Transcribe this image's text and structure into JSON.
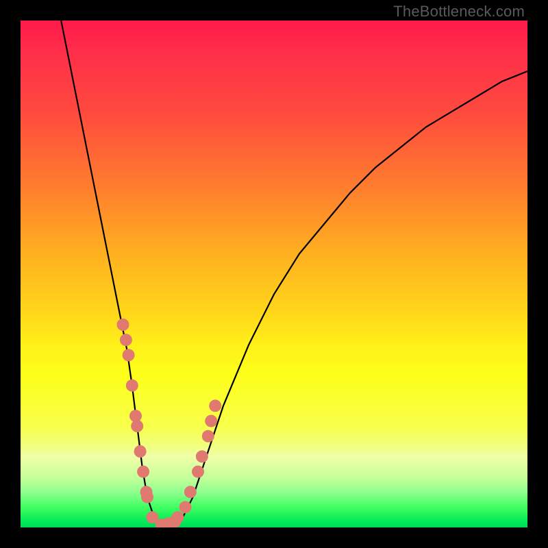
{
  "watermark": "TheBottleneck.com",
  "chart_data": {
    "type": "line",
    "title": "",
    "xlabel": "",
    "ylabel": "",
    "xlim": [
      0,
      100
    ],
    "ylim": [
      0,
      100
    ],
    "curve": {
      "name": "bottleneck-curve",
      "x": [
        8,
        10,
        12,
        14,
        16,
        18,
        20,
        21,
        22,
        23,
        24,
        25,
        26,
        27,
        28,
        30,
        32,
        34,
        36,
        40,
        45,
        50,
        55,
        60,
        65,
        70,
        75,
        80,
        85,
        90,
        95,
        100
      ],
      "y": [
        100,
        90,
        80,
        70,
        60,
        50,
        40,
        35,
        28,
        20,
        12,
        6,
        3,
        1,
        0,
        0,
        2,
        6,
        12,
        24,
        36,
        46,
        54,
        60,
        66,
        71,
        75,
        79,
        82,
        85,
        88,
        90
      ]
    },
    "highlight_points": {
      "name": "laptop-models",
      "x": [
        20.2,
        20.8,
        21.3,
        22.0,
        22.7,
        23.0,
        23.6,
        24.2,
        24.8,
        25.0,
        26.0,
        27.8,
        28.6,
        29.2,
        30.5,
        31.0,
        32.5,
        33.5,
        35.0,
        35.8,
        37.0,
        37.6,
        38.4
      ],
      "y": [
        40,
        37,
        34,
        28,
        22,
        20,
        15,
        11,
        7,
        6,
        2,
        0.5,
        0.5,
        0.8,
        1.2,
        2,
        4,
        7,
        11,
        14,
        18,
        21,
        24
      ]
    },
    "gradient_bands": [
      "red",
      "orange",
      "yellow",
      "green"
    ]
  }
}
